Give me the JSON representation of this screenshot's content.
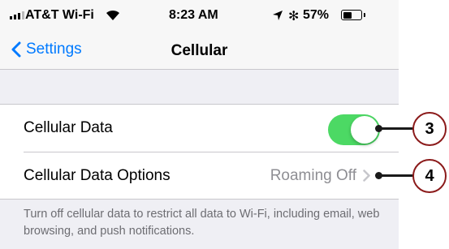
{
  "status_bar": {
    "carrier": "AT&T Wi-Fi",
    "time": "8:23 AM",
    "battery_percent": "57%",
    "battery_level": 0.57,
    "signal_icon": "signal-bars-icon",
    "wifi_icon": "wifi-icon",
    "location_icon": "location-arrow-icon",
    "bluetooth_icon": "bluetooth-icon",
    "bluetooth_glyph": "✻"
  },
  "nav": {
    "back_label": "Settings",
    "title": "Cellular"
  },
  "rows": {
    "cellular_data": {
      "label": "Cellular Data",
      "toggle_on": true
    },
    "options": {
      "label": "Cellular Data Options",
      "value": "Roaming Off"
    }
  },
  "footer_text": "Turn off cellular data to restrict all data to Wi-Fi, including email, web browsing, and push notifications.",
  "callouts": [
    {
      "number": "3"
    },
    {
      "number": "4"
    }
  ],
  "colors": {
    "accent": "#007aff",
    "toggle_on": "#4cd964",
    "callout_ring": "#8b1a1a"
  }
}
